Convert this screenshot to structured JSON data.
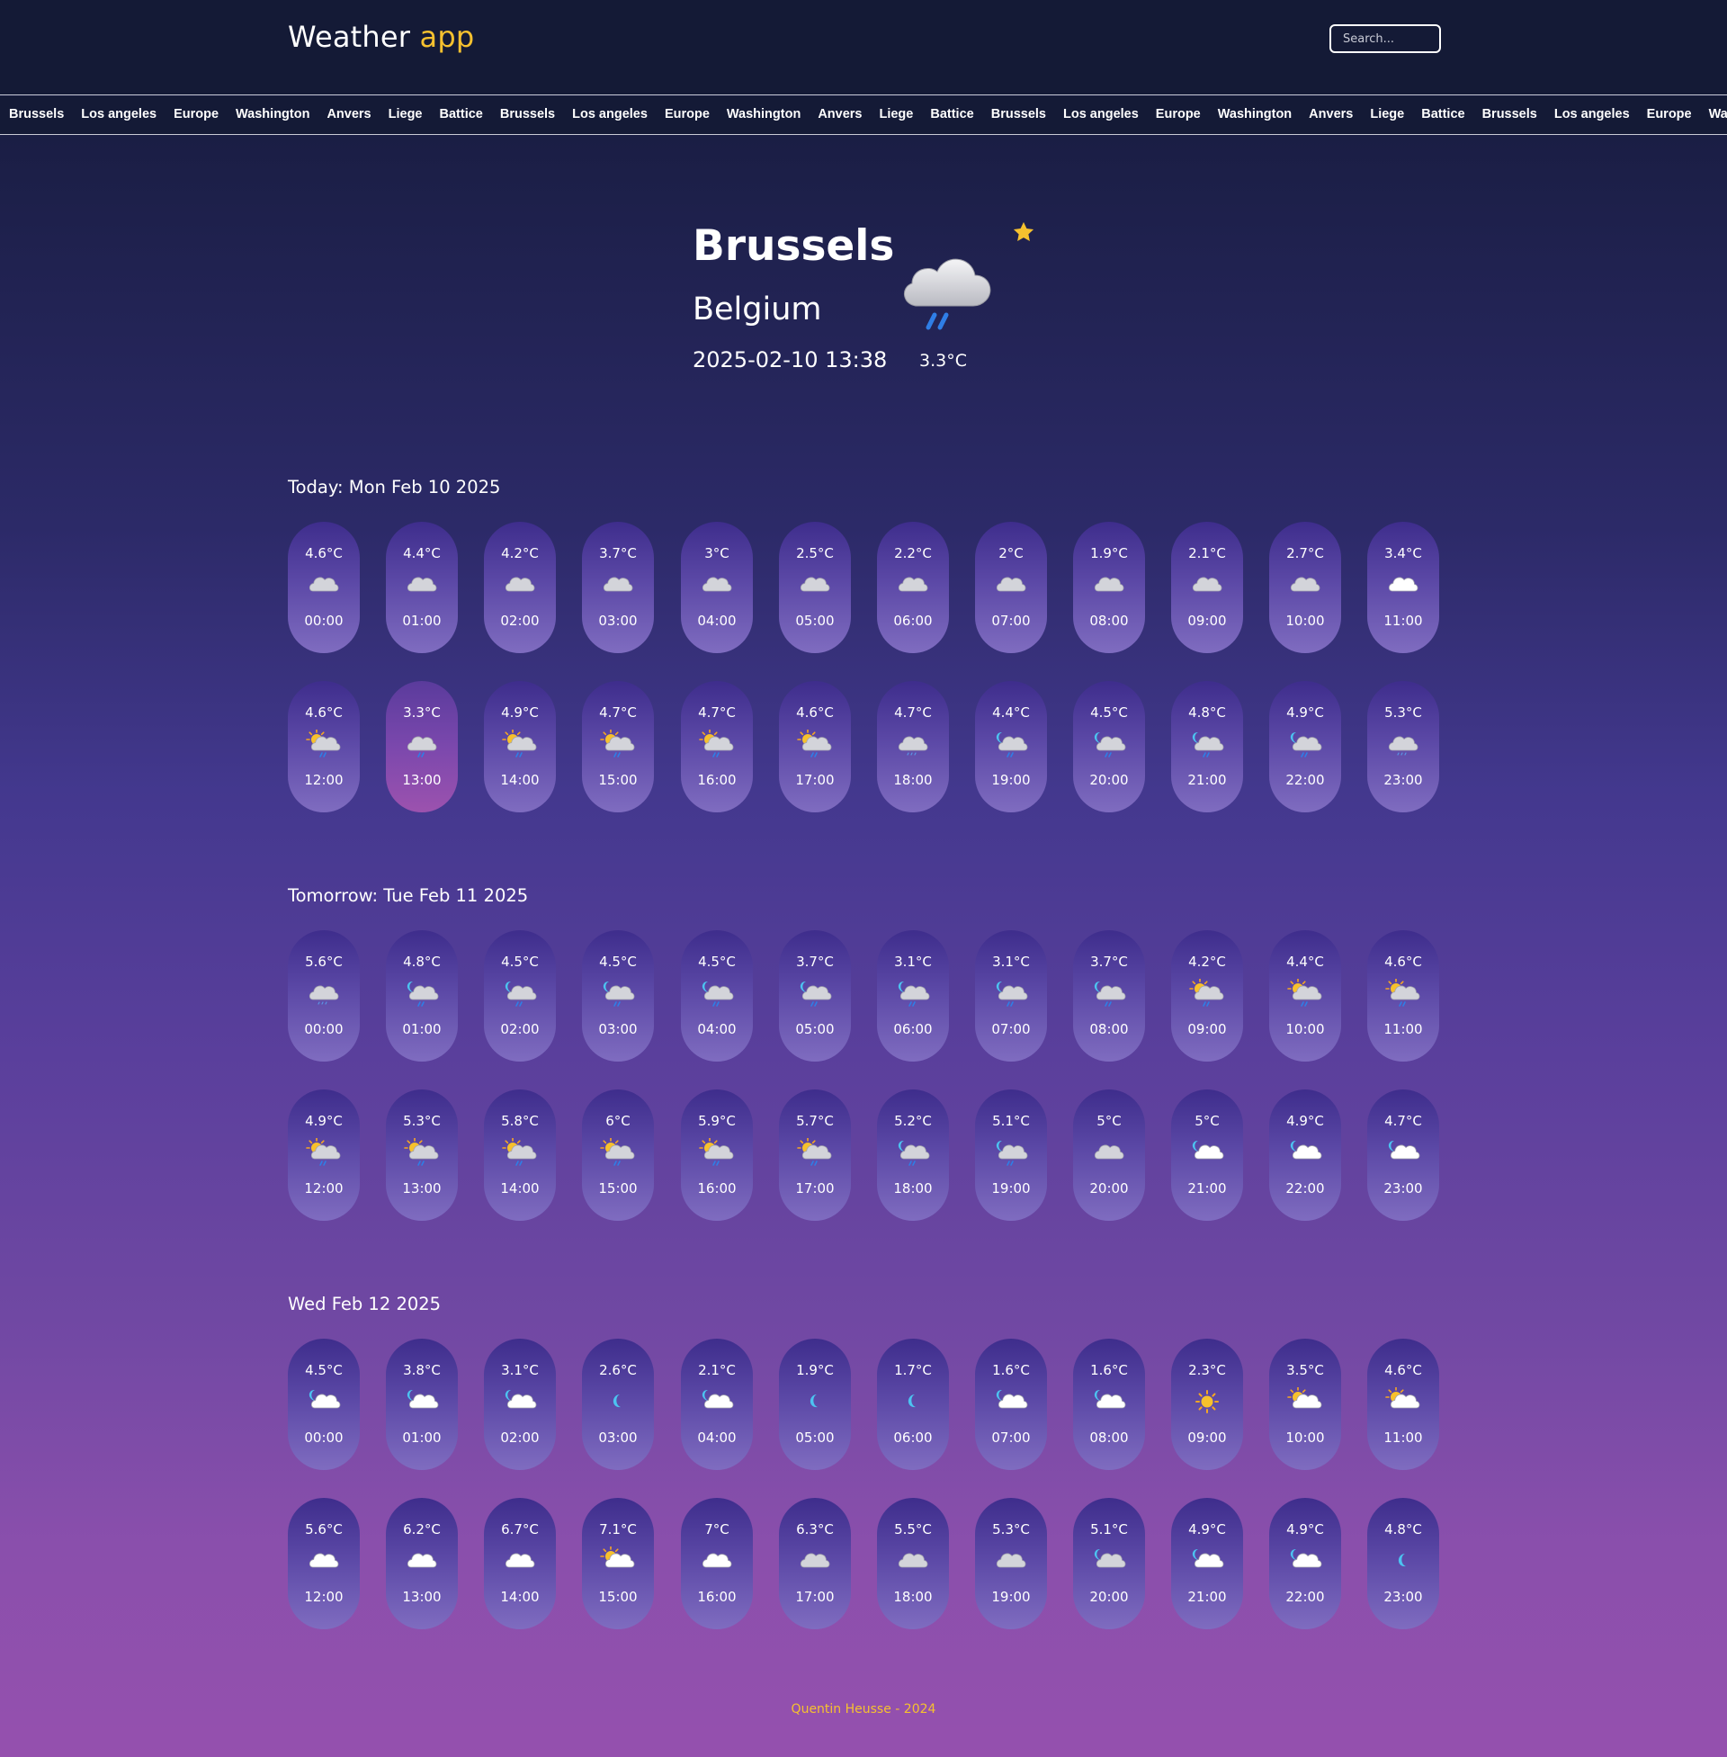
{
  "header": {
    "brand_main": "Weather",
    "brand_accent": "app",
    "search_placeholder": "Search..."
  },
  "ticker": [
    "Brussels",
    "Los angeles",
    "Europe",
    "Washington",
    "Anvers",
    "Liege",
    "Battice",
    "Brussels",
    "Los angeles",
    "Europe",
    "Washington",
    "Anvers",
    "Liege",
    "Battice",
    "Brussels",
    "Los angeles",
    "Europe",
    "Washington",
    "Anvers",
    "Liege",
    "Battice",
    "Brussels",
    "Los angeles",
    "Europe",
    "Washington"
  ],
  "current": {
    "city": "Brussels",
    "country": "Belgium",
    "datetime": "2025-02-10 13:38",
    "temp": "3.3°C",
    "icon": "cloud-rain-icon",
    "favorite": true
  },
  "days": [
    {
      "title": "Today: Mon Feb 10 2025",
      "hours": [
        {
          "time": "00:00",
          "temp": "4.6°C",
          "icon": "cloud-icon"
        },
        {
          "time": "01:00",
          "temp": "4.4°C",
          "icon": "cloud-icon"
        },
        {
          "time": "02:00",
          "temp": "4.2°C",
          "icon": "cloud-icon"
        },
        {
          "time": "03:00",
          "temp": "3.7°C",
          "icon": "cloud-icon"
        },
        {
          "time": "04:00",
          "temp": "3°C",
          "icon": "cloud-icon"
        },
        {
          "time": "05:00",
          "temp": "2.5°C",
          "icon": "cloud-icon"
        },
        {
          "time": "06:00",
          "temp": "2.2°C",
          "icon": "cloud-icon"
        },
        {
          "time": "07:00",
          "temp": "2°C",
          "icon": "cloud-icon"
        },
        {
          "time": "08:00",
          "temp": "1.9°C",
          "icon": "cloud-icon"
        },
        {
          "time": "09:00",
          "temp": "2.1°C",
          "icon": "cloud-icon"
        },
        {
          "time": "10:00",
          "temp": "2.7°C",
          "icon": "cloud-icon"
        },
        {
          "time": "11:00",
          "temp": "3.4°C",
          "icon": "cloud-white-icon"
        },
        {
          "time": "12:00",
          "temp": "4.6°C",
          "icon": "sun-cloud-rain-icon"
        },
        {
          "time": "13:00",
          "temp": "3.3°C",
          "icon": "cloud-rain-icon",
          "current": true
        },
        {
          "time": "14:00",
          "temp": "4.9°C",
          "icon": "sun-cloud-rain-icon"
        },
        {
          "time": "15:00",
          "temp": "4.7°C",
          "icon": "sun-cloud-rain-icon"
        },
        {
          "time": "16:00",
          "temp": "4.7°C",
          "icon": "sun-cloud-rain-icon"
        },
        {
          "time": "17:00",
          "temp": "4.6°C",
          "icon": "sun-cloud-rain-icon"
        },
        {
          "time": "18:00",
          "temp": "4.7°C",
          "icon": "cloud-drizzle-icon"
        },
        {
          "time": "19:00",
          "temp": "4.4°C",
          "icon": "moon-cloud-rain-icon"
        },
        {
          "time": "20:00",
          "temp": "4.5°C",
          "icon": "moon-cloud-rain-icon"
        },
        {
          "time": "21:00",
          "temp": "4.8°C",
          "icon": "moon-cloud-rain-icon"
        },
        {
          "time": "22:00",
          "temp": "4.9°C",
          "icon": "moon-cloud-rain-icon"
        },
        {
          "time": "23:00",
          "temp": "5.3°C",
          "icon": "cloud-drizzle-icon"
        }
      ]
    },
    {
      "title": "Tomorrow: Tue Feb 11 2025",
      "hours": [
        {
          "time": "00:00",
          "temp": "5.6°C",
          "icon": "cloud-drizzle-icon"
        },
        {
          "time": "01:00",
          "temp": "4.8°C",
          "icon": "moon-cloud-rain-icon"
        },
        {
          "time": "02:00",
          "temp": "4.5°C",
          "icon": "moon-cloud-rain-icon"
        },
        {
          "time": "03:00",
          "temp": "4.5°C",
          "icon": "moon-cloud-rain-icon"
        },
        {
          "time": "04:00",
          "temp": "4.5°C",
          "icon": "moon-cloud-rain-icon"
        },
        {
          "time": "05:00",
          "temp": "3.7°C",
          "icon": "moon-cloud-rain-icon"
        },
        {
          "time": "06:00",
          "temp": "3.1°C",
          "icon": "moon-cloud-rain-icon"
        },
        {
          "time": "07:00",
          "temp": "3.1°C",
          "icon": "moon-cloud-rain-icon"
        },
        {
          "time": "08:00",
          "temp": "3.7°C",
          "icon": "moon-cloud-rain-icon"
        },
        {
          "time": "09:00",
          "temp": "4.2°C",
          "icon": "sun-cloud-rain-icon"
        },
        {
          "time": "10:00",
          "temp": "4.4°C",
          "icon": "sun-cloud-rain-icon"
        },
        {
          "time": "11:00",
          "temp": "4.6°C",
          "icon": "sun-cloud-rain-icon"
        },
        {
          "time": "12:00",
          "temp": "4.9°C",
          "icon": "sun-cloud-rain-icon"
        },
        {
          "time": "13:00",
          "temp": "5.3°C",
          "icon": "sun-cloud-rain-icon"
        },
        {
          "time": "14:00",
          "temp": "5.8°C",
          "icon": "sun-cloud-rain-icon"
        },
        {
          "time": "15:00",
          "temp": "6°C",
          "icon": "sun-cloud-rain-icon"
        },
        {
          "time": "16:00",
          "temp": "5.9°C",
          "icon": "sun-cloud-rain-icon"
        },
        {
          "time": "17:00",
          "temp": "5.7°C",
          "icon": "sun-cloud-rain-icon"
        },
        {
          "time": "18:00",
          "temp": "5.2°C",
          "icon": "moon-cloud-rain-icon"
        },
        {
          "time": "19:00",
          "temp": "5.1°C",
          "icon": "moon-cloud-rain-icon"
        },
        {
          "time": "20:00",
          "temp": "5°C",
          "icon": "cloud-icon"
        },
        {
          "time": "21:00",
          "temp": "5°C",
          "icon": "moon-cloud-icon"
        },
        {
          "time": "22:00",
          "temp": "4.9°C",
          "icon": "moon-cloud-icon"
        },
        {
          "time": "23:00",
          "temp": "4.7°C",
          "icon": "moon-cloud-icon"
        }
      ]
    },
    {
      "title": "Wed Feb 12 2025",
      "hours": [
        {
          "time": "00:00",
          "temp": "4.5°C",
          "icon": "moon-cloud-icon"
        },
        {
          "time": "01:00",
          "temp": "3.8°C",
          "icon": "moon-cloud-icon"
        },
        {
          "time": "02:00",
          "temp": "3.1°C",
          "icon": "moon-cloud-icon"
        },
        {
          "time": "03:00",
          "temp": "2.6°C",
          "icon": "moon-icon"
        },
        {
          "time": "04:00",
          "temp": "2.1°C",
          "icon": "moon-cloud-icon"
        },
        {
          "time": "05:00",
          "temp": "1.9°C",
          "icon": "moon-icon"
        },
        {
          "time": "06:00",
          "temp": "1.7°C",
          "icon": "moon-icon"
        },
        {
          "time": "07:00",
          "temp": "1.6°C",
          "icon": "moon-cloud-icon"
        },
        {
          "time": "08:00",
          "temp": "1.6°C",
          "icon": "moon-cloud-icon"
        },
        {
          "time": "09:00",
          "temp": "2.3°C",
          "icon": "sun-icon"
        },
        {
          "time": "10:00",
          "temp": "3.5°C",
          "icon": "sun-cloud-icon"
        },
        {
          "time": "11:00",
          "temp": "4.6°C",
          "icon": "sun-cloud-icon"
        },
        {
          "time": "12:00",
          "temp": "5.6°C",
          "icon": "cloud-white-icon"
        },
        {
          "time": "13:00",
          "temp": "6.2°C",
          "icon": "cloud-white-icon"
        },
        {
          "time": "14:00",
          "temp": "6.7°C",
          "icon": "cloud-white-icon"
        },
        {
          "time": "15:00",
          "temp": "7.1°C",
          "icon": "sun-cloud-icon"
        },
        {
          "time": "16:00",
          "temp": "7°C",
          "icon": "cloud-white-icon"
        },
        {
          "time": "17:00",
          "temp": "6.3°C",
          "icon": "cloud-icon"
        },
        {
          "time": "18:00",
          "temp": "5.5°C",
          "icon": "cloud-icon"
        },
        {
          "time": "19:00",
          "temp": "5.3°C",
          "icon": "cloud-icon"
        },
        {
          "time": "20:00",
          "temp": "5.1°C",
          "icon": "moon-cloud-gray-icon"
        },
        {
          "time": "21:00",
          "temp": "4.9°C",
          "icon": "moon-cloud-icon"
        },
        {
          "time": "22:00",
          "temp": "4.9°C",
          "icon": "moon-cloud-icon"
        },
        {
          "time": "23:00",
          "temp": "4.8°C",
          "icon": "moon-icon"
        }
      ]
    }
  ],
  "footer": {
    "text": "Quentin Heusse - 2024"
  },
  "colors": {
    "accent": "#f6c12f",
    "header_bg": "#141a36"
  }
}
